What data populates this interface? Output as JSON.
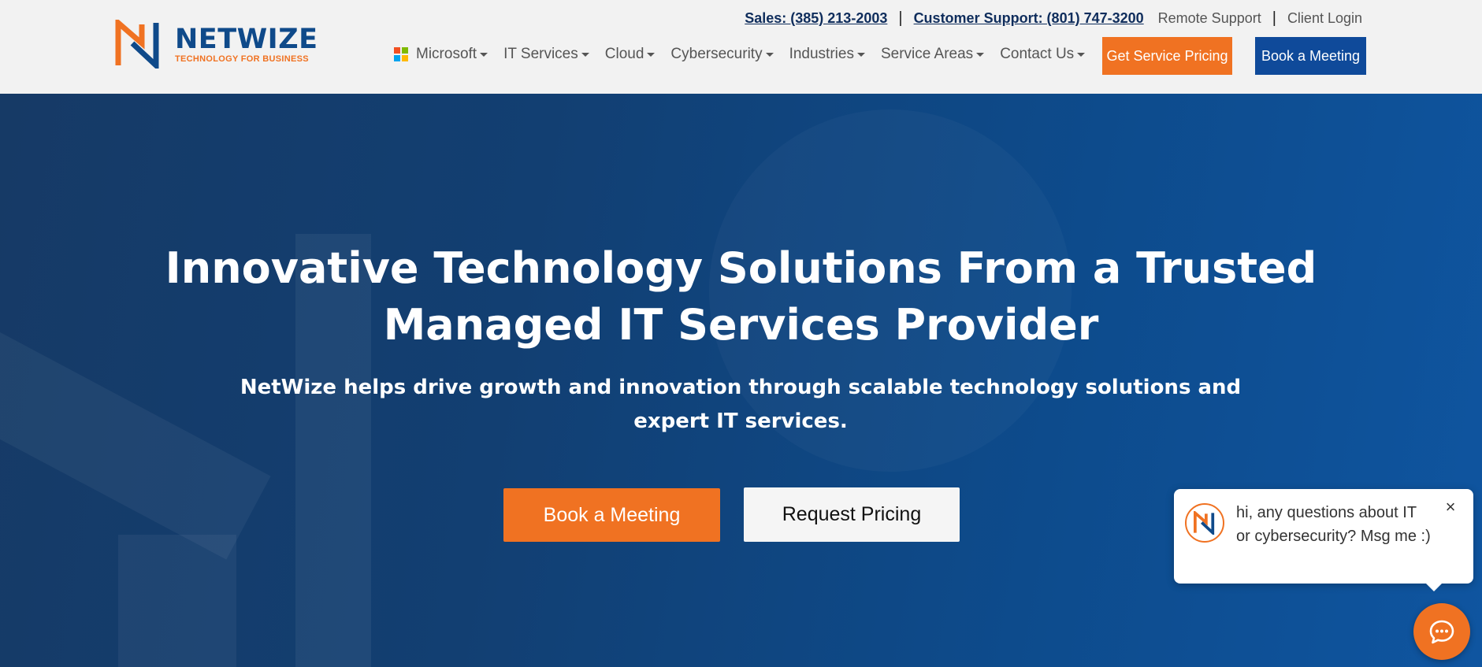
{
  "header": {
    "logo": {
      "name": "NETWIZE",
      "tagline": "TECHNOLOGY FOR BUSINESS"
    },
    "topbar": {
      "sales": "Sales: (385) 213-2003",
      "separator": "|",
      "support": "Customer Support: (801) 747-3200",
      "remote_support": "Remote Support",
      "client_login": "Client Login"
    },
    "nav": [
      {
        "label": "Microsoft"
      },
      {
        "label": "IT Services"
      },
      {
        "label": "Cloud"
      },
      {
        "label": "Cybersecurity"
      },
      {
        "label": "Industries"
      },
      {
        "label": "Service Areas"
      },
      {
        "label": "Contact Us"
      }
    ],
    "get_pricing_label": "Get Service Pricing",
    "book_meeting_label": "Book a Meeting"
  },
  "hero": {
    "title_line1": "Innovative Technology Solutions From a Trusted",
    "title_line2": "Managed IT Services Provider",
    "subtitle": "NetWize helps drive growth and innovation through scalable technology solutions and expert IT services.",
    "book_meeting_label": "Book a Meeting",
    "request_pricing_label": "Request Pricing"
  },
  "chat": {
    "message": "hi, any questions about IT or cybersecurity? Msg me :)",
    "close_symbol": "×"
  },
  "colors": {
    "brand_blue": "#0f4a8a",
    "brand_orange": "#f07222",
    "hero_bg": "#123f72"
  },
  "icons": {
    "logo": "netwize-n-logo",
    "microsoft": "microsoft-icon",
    "caret": "caret-down-icon",
    "chat": "chat-icon",
    "close": "close-icon"
  }
}
